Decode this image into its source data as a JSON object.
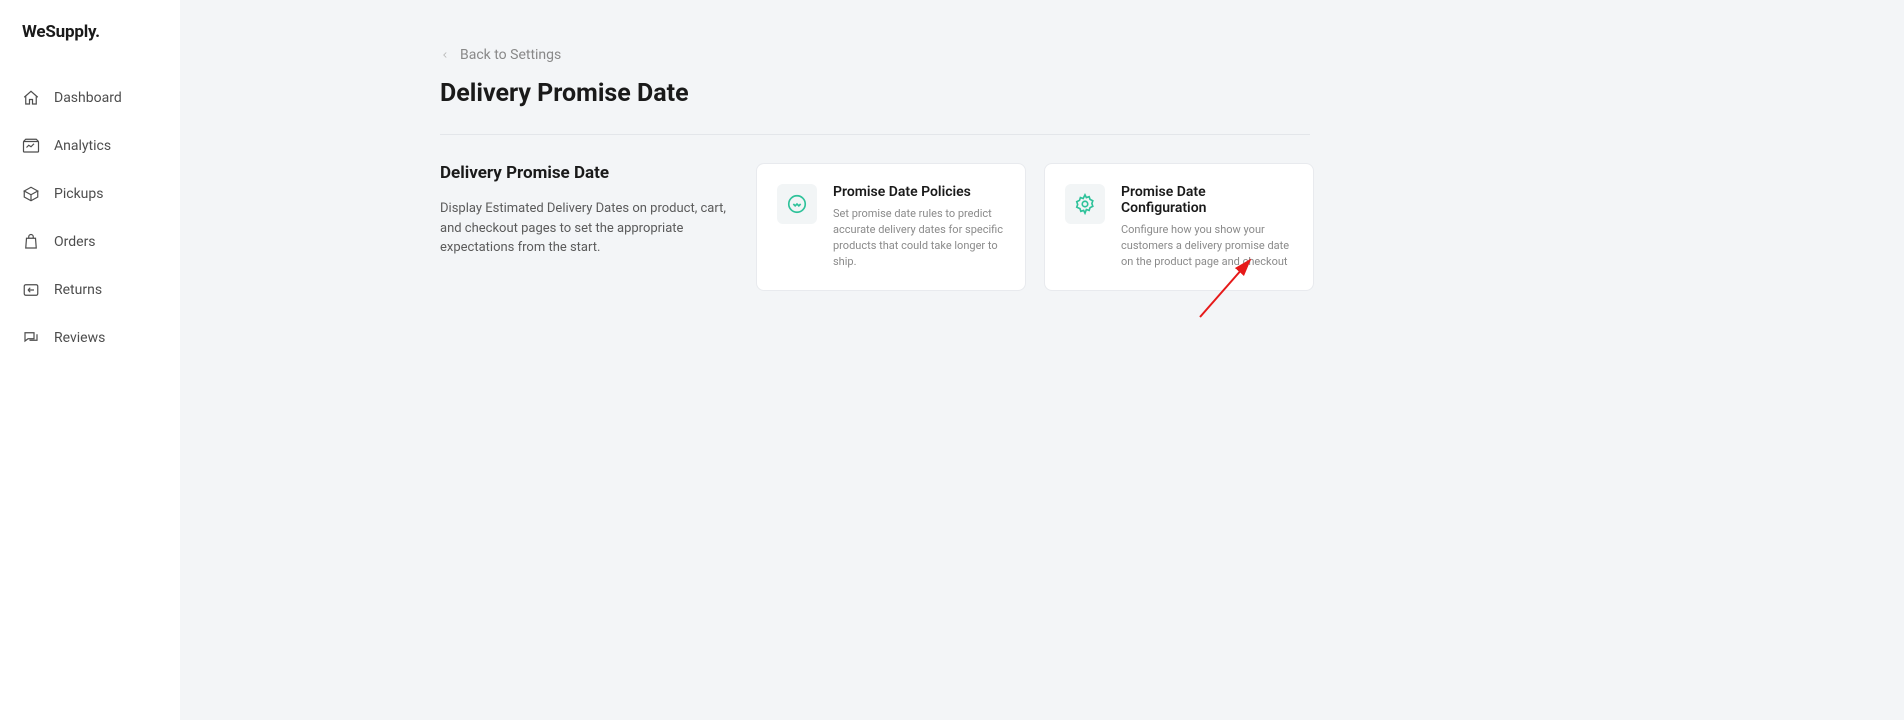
{
  "brand": "WeSupply.",
  "sidebar": {
    "items": [
      {
        "label": "Dashboard"
      },
      {
        "label": "Analytics"
      },
      {
        "label": "Pickups"
      },
      {
        "label": "Orders"
      },
      {
        "label": "Returns"
      },
      {
        "label": "Reviews"
      }
    ]
  },
  "back_label": "Back to Settings",
  "page_title": "Delivery Promise Date",
  "section": {
    "heading": "Delivery Promise Date",
    "description": "Display Estimated Delivery Dates on product, cart, and checkout pages to set the appropriate expectations from the start."
  },
  "cards": [
    {
      "title": "Promise Date Policies",
      "description": "Set promise date rules to predict accurate delivery dates for specific products that could take longer to ship."
    },
    {
      "title": "Promise Date Configuration",
      "description": "Configure how you show your customers a delivery promise date on the product page and checkout"
    }
  ]
}
